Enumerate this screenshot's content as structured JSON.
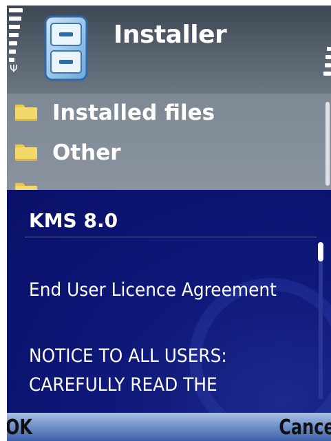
{
  "app": {
    "title": "Installer"
  },
  "file_list": {
    "items": [
      {
        "label": "Installed files",
        "icon": "folder-icon"
      },
      {
        "label": "Other",
        "icon": "folder-icon"
      }
    ]
  },
  "dialog": {
    "title": "KMS 8.0",
    "lines": [
      "End User Licence Agreement",
      "NOTICE TO ALL USERS:",
      "CAREFULLY READ THE"
    ]
  },
  "softkeys": {
    "left": "OK",
    "right": "Cance"
  },
  "colors": {
    "dialog_bg": "#0f197a",
    "title_bar": "#4f5966",
    "softkey_bar": "#6f8ec8",
    "folder": "#f3d86a"
  }
}
